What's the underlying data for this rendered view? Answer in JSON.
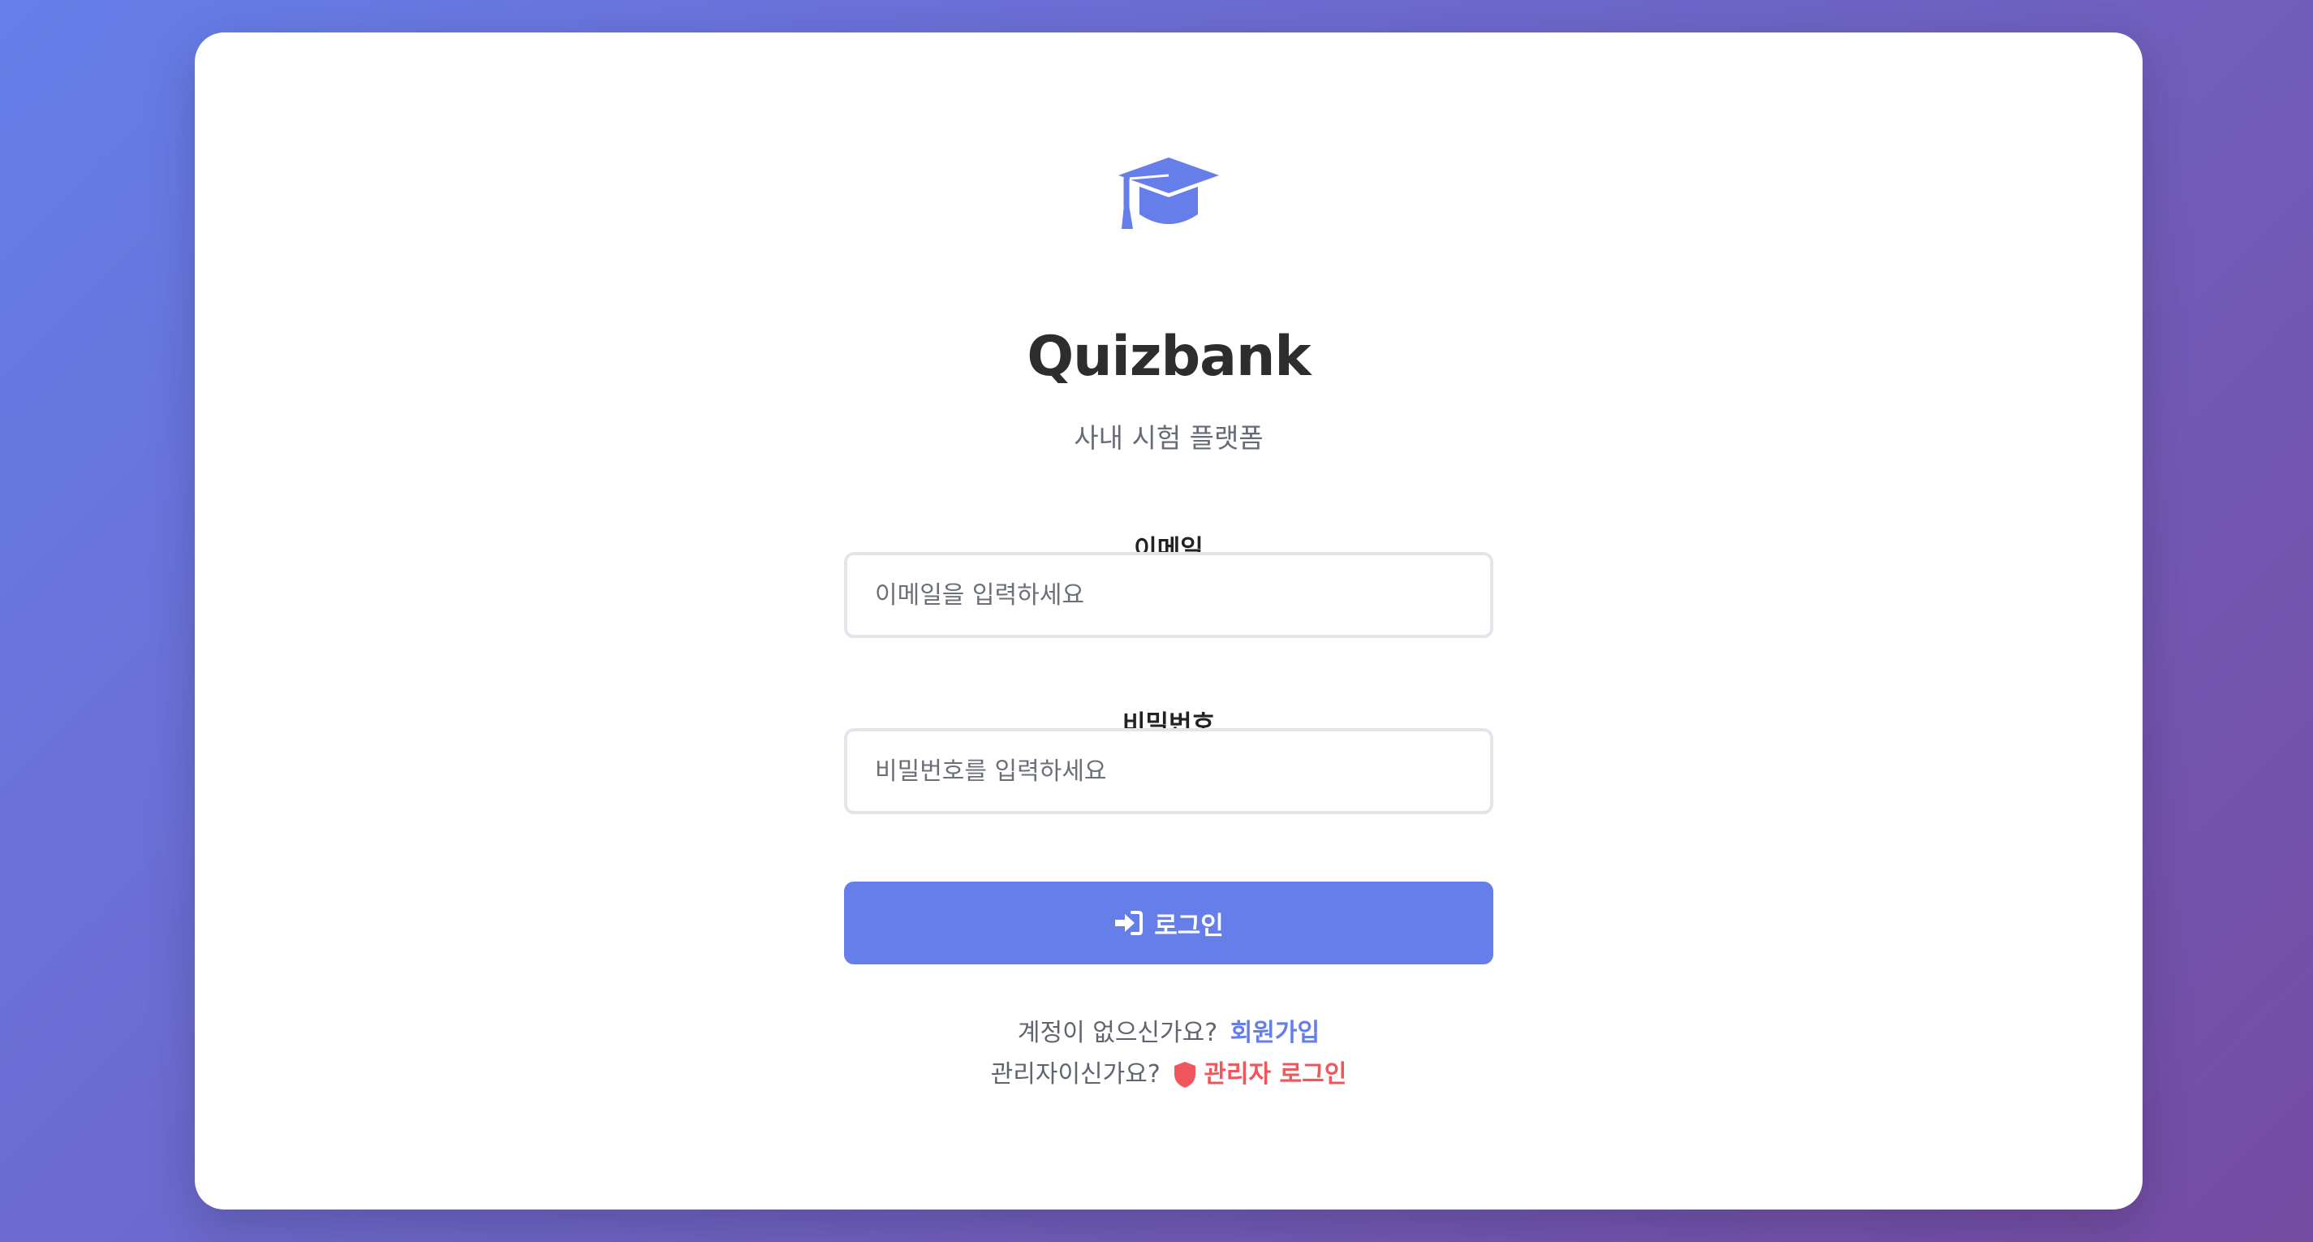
{
  "app": {
    "title": "Quizbank",
    "subtitle": "사내 시험 플랫폼"
  },
  "form": {
    "email": {
      "label": "이메일",
      "placeholder": "이메일을 입력하세요",
      "value": ""
    },
    "password": {
      "label": "비밀번호",
      "placeholder": "비밀번호를 입력하세요",
      "value": ""
    },
    "submit_label": "로그인"
  },
  "footer": {
    "signup_prompt": "계정이 없으신가요?",
    "signup_link": "회원가입",
    "admin_prompt": "관리자이신가요?",
    "admin_link": "관리자 로그인"
  },
  "icons": {
    "logo": "graduation-cap-icon",
    "login": "sign-in-icon",
    "admin": "shield-icon"
  },
  "colors": {
    "accent": "#667eea",
    "admin": "#f0565c",
    "background_start": "#667eea",
    "background_end": "#764ba2"
  }
}
